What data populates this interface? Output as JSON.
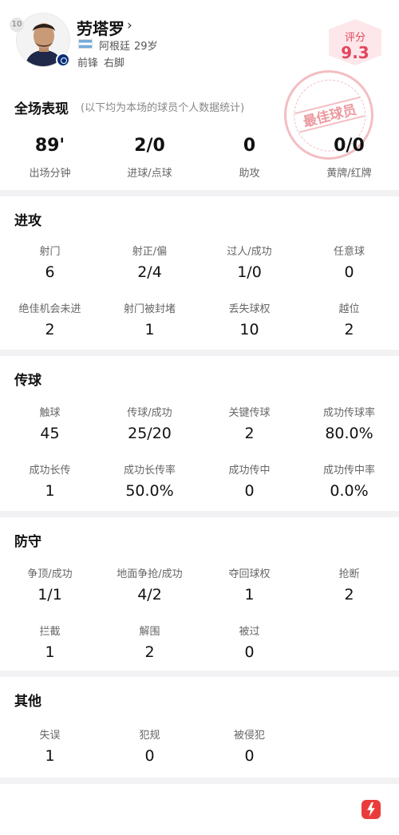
{
  "player": {
    "number": "10",
    "name": "劳塔罗",
    "chevron": "›",
    "country": "阿根廷",
    "age": "29岁",
    "position": "前锋",
    "foot": "右脚",
    "flag_icon": "argentina-flag-icon",
    "club_icon": "inter-milan-logo-icon"
  },
  "rating": {
    "label": "评分",
    "value": "9.3",
    "color": "#e2455e"
  },
  "stamp": {
    "text": "最佳球员"
  },
  "overall": {
    "title": "全场表现",
    "note": "(以下均为本场的球员个人数据统计)",
    "stats": [
      {
        "value": "89'",
        "label": "出场分钟"
      },
      {
        "value": "2/0",
        "label": "进球/点球"
      },
      {
        "value": "0",
        "label": "助攻"
      },
      {
        "value": "0/0",
        "label": "黄牌/红牌"
      }
    ]
  },
  "attack": {
    "title": "进攻",
    "rows": [
      [
        {
          "label": "射门",
          "value": "6"
        },
        {
          "label": "射正/偏",
          "value": "2/4"
        },
        {
          "label": "过人/成功",
          "value": "1/0"
        },
        {
          "label": "任意球",
          "value": "0"
        }
      ],
      [
        {
          "label": "绝佳机会未进",
          "value": "2"
        },
        {
          "label": "射门被封堵",
          "value": "1"
        },
        {
          "label": "丢失球权",
          "value": "10"
        },
        {
          "label": "越位",
          "value": "2"
        }
      ]
    ]
  },
  "passing": {
    "title": "传球",
    "rows": [
      [
        {
          "label": "触球",
          "value": "45"
        },
        {
          "label": "传球/成功",
          "value": "25/20"
        },
        {
          "label": "关键传球",
          "value": "2"
        },
        {
          "label": "成功传球率",
          "value": "80.0%"
        }
      ],
      [
        {
          "label": "成功长传",
          "value": "1"
        },
        {
          "label": "成功长传率",
          "value": "50.0%"
        },
        {
          "label": "成功传中",
          "value": "0"
        },
        {
          "label": "成功传中率",
          "value": "0.0%"
        }
      ]
    ]
  },
  "defense": {
    "title": "防守",
    "rows": [
      [
        {
          "label": "争顶/成功",
          "value": "1/1"
        },
        {
          "label": "地面争抢/成功",
          "value": "4/2"
        },
        {
          "label": "夺回球权",
          "value": "1"
        },
        {
          "label": "抢断",
          "value": "2"
        }
      ],
      [
        {
          "label": "拦截",
          "value": "1"
        },
        {
          "label": "解围",
          "value": "2"
        },
        {
          "label": "被过",
          "value": "0"
        }
      ]
    ]
  },
  "other": {
    "title": "其他",
    "rows": [
      [
        {
          "label": "失误",
          "value": "1"
        },
        {
          "label": "犯规",
          "value": "0"
        },
        {
          "label": "被侵犯",
          "value": "0"
        }
      ]
    ]
  },
  "footer": {
    "logo_icon": "app-logo-icon",
    "logo_color": "#ea3b3b"
  }
}
